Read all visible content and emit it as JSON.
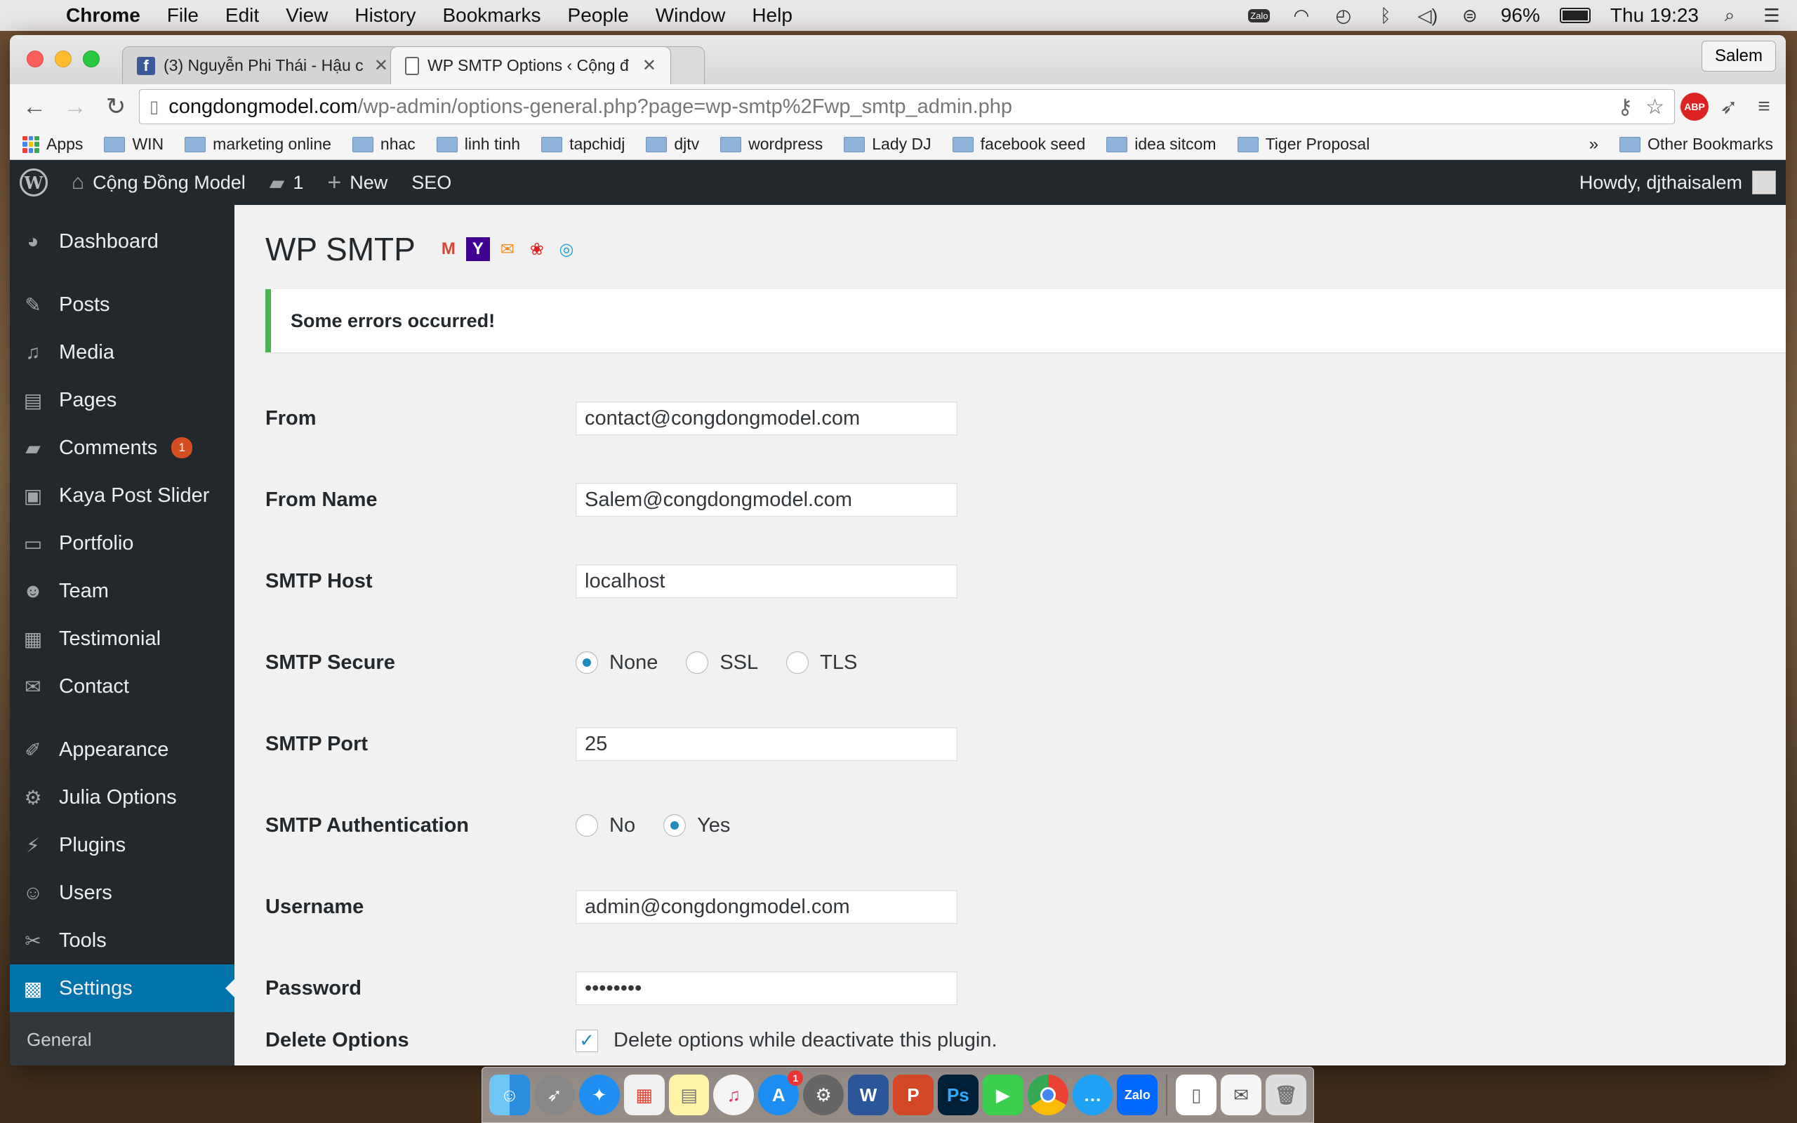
{
  "menubar": {
    "app_name": "Chrome",
    "items": [
      "File",
      "Edit",
      "View",
      "History",
      "Bookmarks",
      "People",
      "Window",
      "Help"
    ],
    "zalo_label": "Zalo",
    "battery": "96%",
    "clock": "Thu 19:23"
  },
  "browser": {
    "tabs": [
      {
        "title": "(3) Nguyễn Phi Thái - Hậu c",
        "icon": "facebook-icon",
        "active": false
      },
      {
        "title": "WP SMTP Options ‹ Cộng đ",
        "icon": "document-icon",
        "active": true
      }
    ],
    "profile": "Salem",
    "url_host": "congdongmodel.com",
    "url_path": "/wp-admin/options-general.php?page=wp-smtp%2Fwp_smtp_admin.php",
    "abp_label": "ABP",
    "bookmarks": [
      "Apps",
      "WIN",
      "marketing online",
      "nhac",
      "linh tinh",
      "tapchidj",
      "djtv",
      "wordpress",
      "Lady DJ",
      "facebook seed",
      "idea sitcom",
      "Tiger Proposal"
    ],
    "bookmarks_more": "»",
    "other_bookmarks": "Other Bookmarks"
  },
  "adminbar": {
    "site_name": "Cộng Đồng Model",
    "comments_count": "1",
    "new_label": "New",
    "seo_label": "SEO",
    "howdy": "Howdy, djthaisalem"
  },
  "sidebar": {
    "items": [
      {
        "label": "Dashboard",
        "icon": "dashboard-icon"
      },
      {
        "label": "Posts",
        "icon": "pin-icon"
      },
      {
        "label": "Media",
        "icon": "media-icon"
      },
      {
        "label": "Pages",
        "icon": "pages-icon"
      },
      {
        "label": "Comments",
        "icon": "comment-icon",
        "badge": "1"
      },
      {
        "label": "Kaya Post Slider",
        "icon": "image-icon"
      },
      {
        "label": "Portfolio",
        "icon": "folder-icon"
      },
      {
        "label": "Team",
        "icon": "team-icon"
      },
      {
        "label": "Testimonial",
        "icon": "testimonial-icon"
      },
      {
        "label": "Contact",
        "icon": "mail-icon"
      },
      {
        "label": "Appearance",
        "icon": "brush-icon"
      },
      {
        "label": "Julia Options",
        "icon": "gear-icon"
      },
      {
        "label": "Plugins",
        "icon": "plug-icon"
      },
      {
        "label": "Users",
        "icon": "user-icon"
      },
      {
        "label": "Tools",
        "icon": "wrench-icon"
      },
      {
        "label": "Settings",
        "icon": "settings-icon"
      }
    ],
    "submenu_first": "General"
  },
  "page": {
    "title": "WP SMTP",
    "notice": "Some errors occurred!",
    "fields": {
      "from_label": "From",
      "from_value": "contact@congdongmodel.com",
      "from_name_label": "From Name",
      "from_name_value": "Salem@congdongmodel.com",
      "host_label": "SMTP Host",
      "host_value": "localhost",
      "secure_label": "SMTP Secure",
      "secure_options": [
        "None",
        "SSL",
        "TLS"
      ],
      "secure_selected": "None",
      "port_label": "SMTP Port",
      "port_value": "25",
      "auth_label": "SMTP Authentication",
      "auth_options": [
        "No",
        "Yes"
      ],
      "auth_selected": "Yes",
      "username_label": "Username",
      "username_value": "admin@congdongmodel.com",
      "password_label": "Password",
      "password_value": "••••••••",
      "delete_label": "Delete Options",
      "delete_checkbox_label": "Delete options while deactivate this plugin."
    }
  },
  "colors": {
    "admin_dark": "#23282d",
    "admin_blue": "#0073aa",
    "notice_green": "#46b450",
    "badge_orange": "#d54e21"
  }
}
